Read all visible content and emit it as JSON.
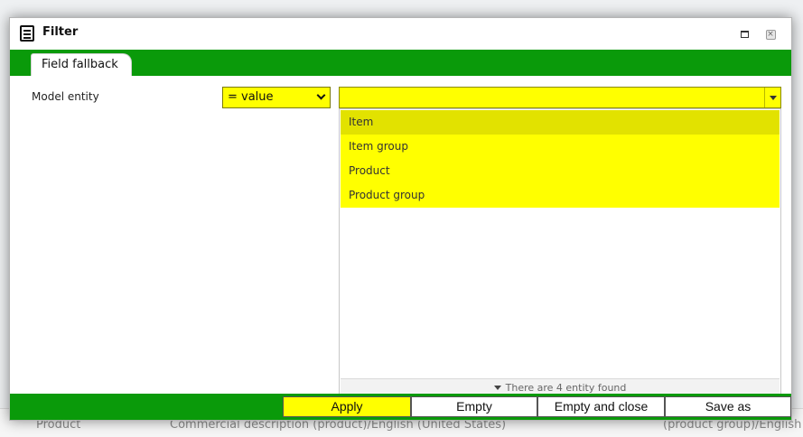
{
  "background": {
    "row": [
      "Product",
      "Commercial description (product)/English (United States)",
      "(product group)/English"
    ]
  },
  "dialog": {
    "title": "Filter",
    "title_icon": "list-window-icon",
    "maximize_icon": "maximize-icon",
    "close_icon": "close-icon",
    "tab_label": "Field fallback"
  },
  "filter": {
    "field_label": "Model entity",
    "operator_value": "= value",
    "combo_value": "",
    "options": [
      "Item",
      "Item group",
      "Product",
      "Product group"
    ],
    "highlighted_option": "Item",
    "footer_text": "There are 4 entity found"
  },
  "buttons": {
    "apply": "Apply",
    "empty": "Empty",
    "empty_and_close": "Empty and close",
    "save_as": "Save as"
  },
  "colors": {
    "accent_green": "#0a9a0a",
    "field_yellow": "#ffff00",
    "highlight_yellow": "#e2e200"
  }
}
